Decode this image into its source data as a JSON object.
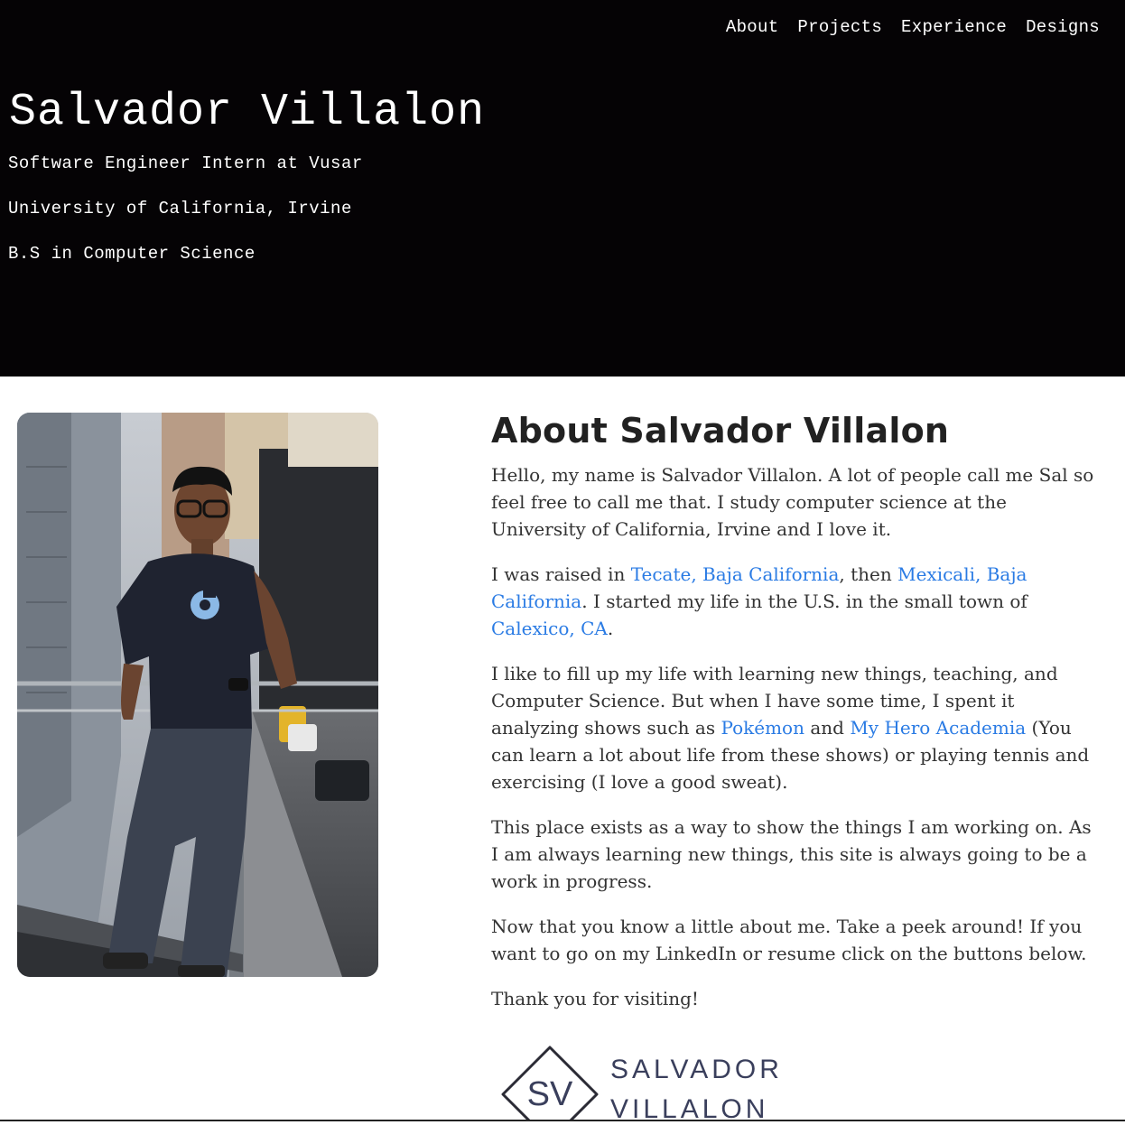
{
  "nav": {
    "items": [
      {
        "label": "About"
      },
      {
        "label": "Projects"
      },
      {
        "label": "Experience"
      },
      {
        "label": "Designs"
      }
    ]
  },
  "hero": {
    "name": "Salvador Villalon",
    "role": "Software Engineer Intern at Vusar",
    "school": "University of California, Irvine",
    "degree": "B.S in Computer Science",
    "background_color": "#050305"
  },
  "photo": {
    "icon": "person-photo-icon",
    "shirt_logo_icon": "circleci-logo-icon"
  },
  "about": {
    "heading": "About Salvador Villalon",
    "link_color": "#2a7be4",
    "p1": "Hello, my name is Salvador Villalon. A lot of people call me Sal so feel free to call me that. I study computer science at the University of California, Irvine and I love it.",
    "p2_t1": "I was raised in ",
    "p2_link1": "Tecate, Baja California",
    "p2_t2": ", then ",
    "p2_link2": "Mexicali, Baja California",
    "p2_t3": ". I started my life in the U.S. in the small town of ",
    "p2_link3": "Calexico, CA",
    "p2_t4": ".",
    "p3_t1": "I like to fill up my life with learning new things, teaching, and Computer Science. But when I have some time, I spent it analyzing shows such as ",
    "p3_link1": "Pokémon",
    "p3_t2": " and ",
    "p3_link2": "My Hero Academia",
    "p3_t3": " (You can learn a lot about life from these shows) or playing tennis and exercising (I love a good sweat).",
    "p4": "This place exists as a way to show the things I am working on. As I am always learning new things, this site is always going to be a work in progress.",
    "p5": "Now that you know a little about me. Take a peek around! If you want to go on my LinkedIn or resume click on the buttons below.",
    "p6": "Thank you for visiting!"
  },
  "logo": {
    "monogram": "SV",
    "line1": "SALVADOR",
    "line2": "VILLALON",
    "color": "#3a3f5c"
  }
}
